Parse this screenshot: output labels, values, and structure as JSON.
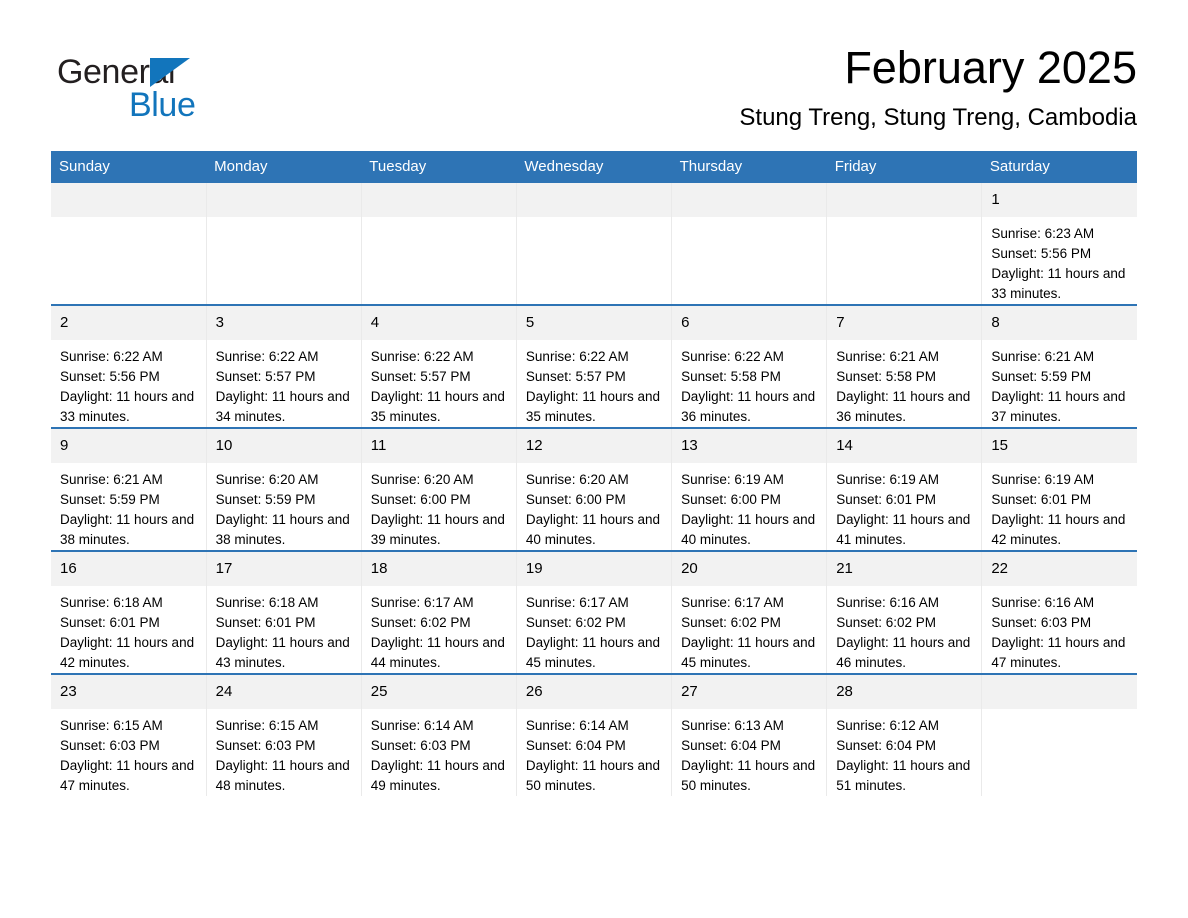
{
  "brand": {
    "name_part1": "General",
    "name_part2": "Blue",
    "logo_icon": "triangle-icon",
    "primary_color": "#1275bc",
    "text_color": "#231f20"
  },
  "header": {
    "title": "February 2025",
    "location": "Stung Treng, Stung Treng, Cambodia"
  },
  "theme": {
    "header_blue": "#2e74b5",
    "daynum_band": "#f2f2f2",
    "cell_divider": "#eaeaea"
  },
  "weekdays": [
    "Sunday",
    "Monday",
    "Tuesday",
    "Wednesday",
    "Thursday",
    "Friday",
    "Saturday"
  ],
  "weeks": [
    [
      {
        "day": "",
        "sunrise": "",
        "sunset": "",
        "daylight": ""
      },
      {
        "day": "",
        "sunrise": "",
        "sunset": "",
        "daylight": ""
      },
      {
        "day": "",
        "sunrise": "",
        "sunset": "",
        "daylight": ""
      },
      {
        "day": "",
        "sunrise": "",
        "sunset": "",
        "daylight": ""
      },
      {
        "day": "",
        "sunrise": "",
        "sunset": "",
        "daylight": ""
      },
      {
        "day": "",
        "sunrise": "",
        "sunset": "",
        "daylight": ""
      },
      {
        "day": "1",
        "sunrise": "Sunrise: 6:23 AM",
        "sunset": "Sunset: 5:56 PM",
        "daylight": "Daylight: 11 hours and 33 minutes."
      }
    ],
    [
      {
        "day": "2",
        "sunrise": "Sunrise: 6:22 AM",
        "sunset": "Sunset: 5:56 PM",
        "daylight": "Daylight: 11 hours and 33 minutes."
      },
      {
        "day": "3",
        "sunrise": "Sunrise: 6:22 AM",
        "sunset": "Sunset: 5:57 PM",
        "daylight": "Daylight: 11 hours and 34 minutes."
      },
      {
        "day": "4",
        "sunrise": "Sunrise: 6:22 AM",
        "sunset": "Sunset: 5:57 PM",
        "daylight": "Daylight: 11 hours and 35 minutes."
      },
      {
        "day": "5",
        "sunrise": "Sunrise: 6:22 AM",
        "sunset": "Sunset: 5:57 PM",
        "daylight": "Daylight: 11 hours and 35 minutes."
      },
      {
        "day": "6",
        "sunrise": "Sunrise: 6:22 AM",
        "sunset": "Sunset: 5:58 PM",
        "daylight": "Daylight: 11 hours and 36 minutes."
      },
      {
        "day": "7",
        "sunrise": "Sunrise: 6:21 AM",
        "sunset": "Sunset: 5:58 PM",
        "daylight": "Daylight: 11 hours and 36 minutes."
      },
      {
        "day": "8",
        "sunrise": "Sunrise: 6:21 AM",
        "sunset": "Sunset: 5:59 PM",
        "daylight": "Daylight: 11 hours and 37 minutes."
      }
    ],
    [
      {
        "day": "9",
        "sunrise": "Sunrise: 6:21 AM",
        "sunset": "Sunset: 5:59 PM",
        "daylight": "Daylight: 11 hours and 38 minutes."
      },
      {
        "day": "10",
        "sunrise": "Sunrise: 6:20 AM",
        "sunset": "Sunset: 5:59 PM",
        "daylight": "Daylight: 11 hours and 38 minutes."
      },
      {
        "day": "11",
        "sunrise": "Sunrise: 6:20 AM",
        "sunset": "Sunset: 6:00 PM",
        "daylight": "Daylight: 11 hours and 39 minutes."
      },
      {
        "day": "12",
        "sunrise": "Sunrise: 6:20 AM",
        "sunset": "Sunset: 6:00 PM",
        "daylight": "Daylight: 11 hours and 40 minutes."
      },
      {
        "day": "13",
        "sunrise": "Sunrise: 6:19 AM",
        "sunset": "Sunset: 6:00 PM",
        "daylight": "Daylight: 11 hours and 40 minutes."
      },
      {
        "day": "14",
        "sunrise": "Sunrise: 6:19 AM",
        "sunset": "Sunset: 6:01 PM",
        "daylight": "Daylight: 11 hours and 41 minutes."
      },
      {
        "day": "15",
        "sunrise": "Sunrise: 6:19 AM",
        "sunset": "Sunset: 6:01 PM",
        "daylight": "Daylight: 11 hours and 42 minutes."
      }
    ],
    [
      {
        "day": "16",
        "sunrise": "Sunrise: 6:18 AM",
        "sunset": "Sunset: 6:01 PM",
        "daylight": "Daylight: 11 hours and 42 minutes."
      },
      {
        "day": "17",
        "sunrise": "Sunrise: 6:18 AM",
        "sunset": "Sunset: 6:01 PM",
        "daylight": "Daylight: 11 hours and 43 minutes."
      },
      {
        "day": "18",
        "sunrise": "Sunrise: 6:17 AM",
        "sunset": "Sunset: 6:02 PM",
        "daylight": "Daylight: 11 hours and 44 minutes."
      },
      {
        "day": "19",
        "sunrise": "Sunrise: 6:17 AM",
        "sunset": "Sunset: 6:02 PM",
        "daylight": "Daylight: 11 hours and 45 minutes."
      },
      {
        "day": "20",
        "sunrise": "Sunrise: 6:17 AM",
        "sunset": "Sunset: 6:02 PM",
        "daylight": "Daylight: 11 hours and 45 minutes."
      },
      {
        "day": "21",
        "sunrise": "Sunrise: 6:16 AM",
        "sunset": "Sunset: 6:02 PM",
        "daylight": "Daylight: 11 hours and 46 minutes."
      },
      {
        "day": "22",
        "sunrise": "Sunrise: 6:16 AM",
        "sunset": "Sunset: 6:03 PM",
        "daylight": "Daylight: 11 hours and 47 minutes."
      }
    ],
    [
      {
        "day": "23",
        "sunrise": "Sunrise: 6:15 AM",
        "sunset": "Sunset: 6:03 PM",
        "daylight": "Daylight: 11 hours and 47 minutes."
      },
      {
        "day": "24",
        "sunrise": "Sunrise: 6:15 AM",
        "sunset": "Sunset: 6:03 PM",
        "daylight": "Daylight: 11 hours and 48 minutes."
      },
      {
        "day": "25",
        "sunrise": "Sunrise: 6:14 AM",
        "sunset": "Sunset: 6:03 PM",
        "daylight": "Daylight: 11 hours and 49 minutes."
      },
      {
        "day": "26",
        "sunrise": "Sunrise: 6:14 AM",
        "sunset": "Sunset: 6:04 PM",
        "daylight": "Daylight: 11 hours and 50 minutes."
      },
      {
        "day": "27",
        "sunrise": "Sunrise: 6:13 AM",
        "sunset": "Sunset: 6:04 PM",
        "daylight": "Daylight: 11 hours and 50 minutes."
      },
      {
        "day": "28",
        "sunrise": "Sunrise: 6:12 AM",
        "sunset": "Sunset: 6:04 PM",
        "daylight": "Daylight: 11 hours and 51 minutes."
      },
      {
        "day": "",
        "sunrise": "",
        "sunset": "",
        "daylight": ""
      }
    ]
  ]
}
